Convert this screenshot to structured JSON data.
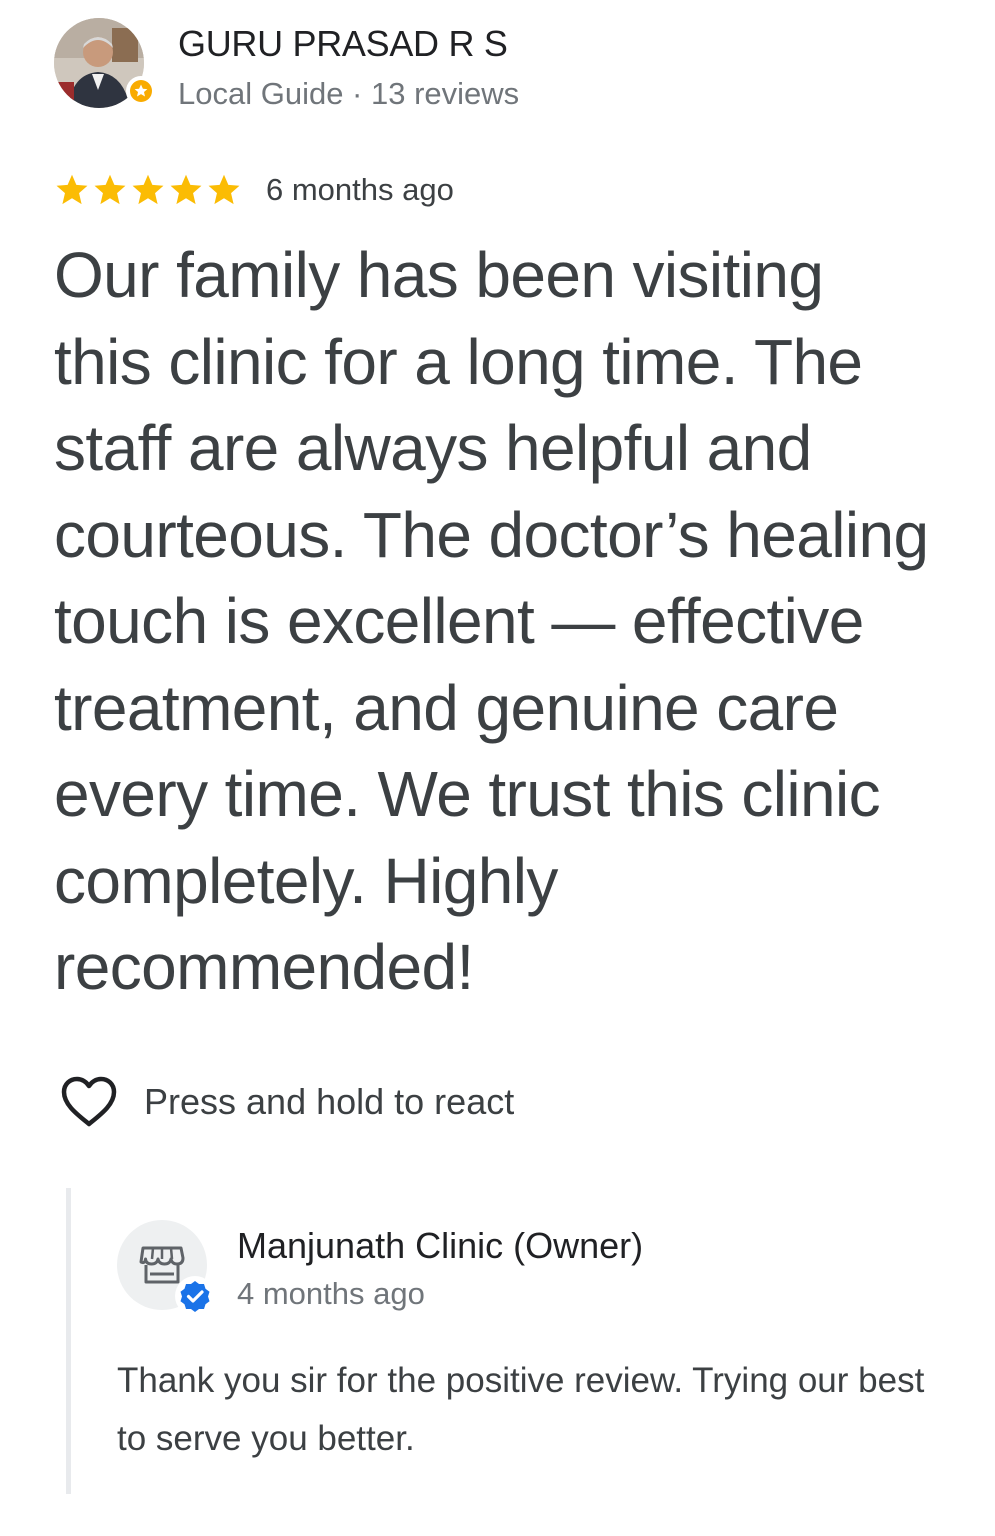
{
  "review": {
    "reviewer_name": "GURU PRASAD R S",
    "reviewer_subtitle": "Local Guide · 13 reviews",
    "avatar_icon": "person-photo",
    "badge_icon": "local-guide-star-icon",
    "rating": 5,
    "rating_max": 5,
    "time": "6 months ago",
    "text": "Our family has been visiting this clinic for a long time. The staff are always helpful and courteous. The doctor’s healing touch is excellent — effective treatment, and genuine care every time. We trust this clinic completely. Highly recommended!"
  },
  "reaction": {
    "icon": "heart-outline-icon",
    "label": "Press and hold to react"
  },
  "owner_reply": {
    "name": "Manjunath Clinic (Owner)",
    "time": "4 months ago",
    "avatar_icon": "storefront-icon",
    "badge_icon": "verified-check-icon",
    "text": "Thank you sir for the positive review. Trying our best to serve you better."
  },
  "colors": {
    "star": "#fbbc04",
    "text": "#3c4043",
    "secondary_text": "#70757a",
    "verified": "#1a73e8",
    "guide_badge": "#f9ab00",
    "divider": "#e8eaed"
  }
}
